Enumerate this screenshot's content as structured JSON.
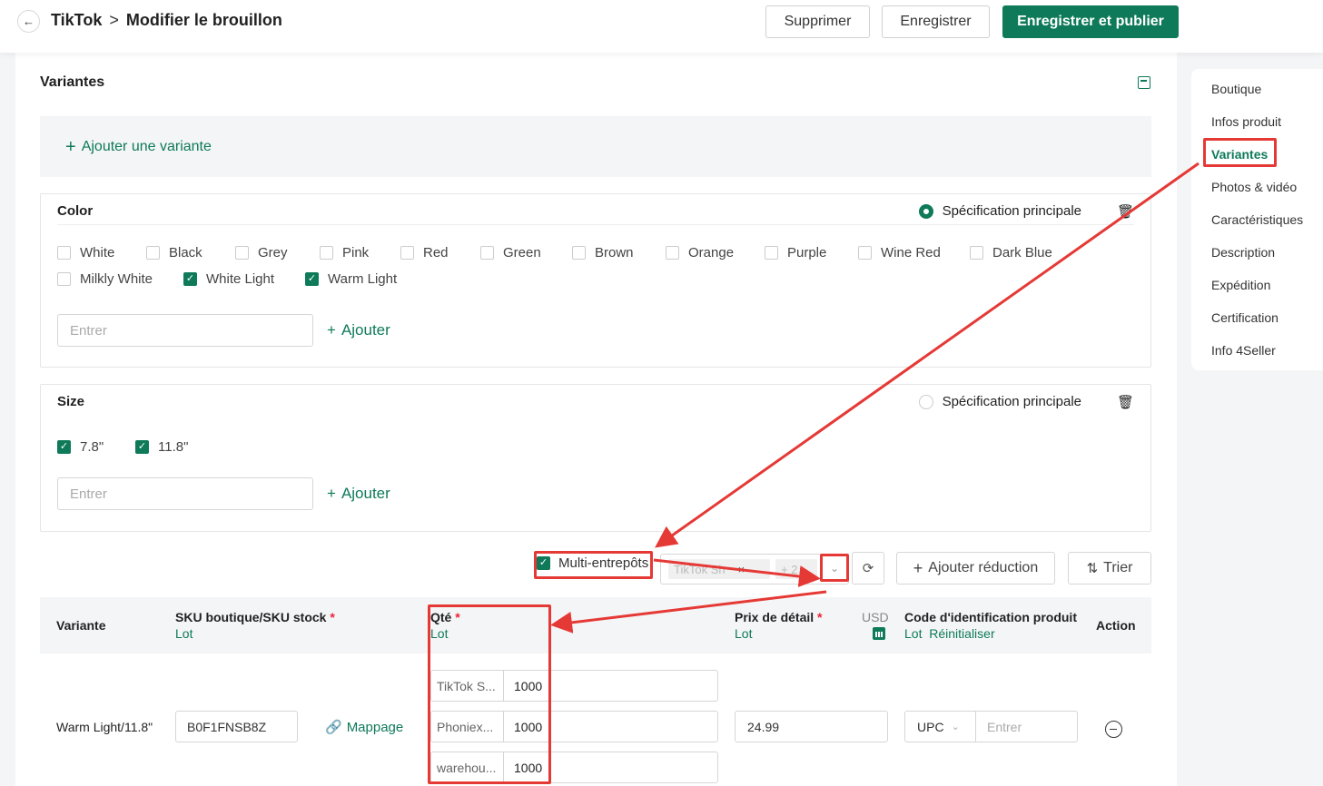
{
  "header": {
    "back_icon": "arrow-left-icon",
    "breadcrumb_root": "TikTok",
    "breadcrumb_sep": ">",
    "breadcrumb_current": "Modifier le brouillon",
    "delete_label": "Supprimer",
    "save_label": "Enregistrer",
    "publish_label": "Enregistrer et publier"
  },
  "section": {
    "title": "Variantes",
    "add_variant_label": "Ajouter une variante"
  },
  "color_spec": {
    "title": "Color",
    "main_spec_label": "Spécification principale",
    "main_spec_selected": true,
    "options": [
      {
        "label": "White",
        "checked": false
      },
      {
        "label": "Black",
        "checked": false
      },
      {
        "label": "Grey",
        "checked": false
      },
      {
        "label": "Pink",
        "checked": false
      },
      {
        "label": "Red",
        "checked": false
      },
      {
        "label": "Green",
        "checked": false
      },
      {
        "label": "Brown",
        "checked": false
      },
      {
        "label": "Orange",
        "checked": false
      },
      {
        "label": "Purple",
        "checked": false
      },
      {
        "label": "Wine Red",
        "checked": false
      },
      {
        "label": "Dark Blue",
        "checked": false
      },
      {
        "label": "Milkly White",
        "checked": false
      },
      {
        "label": "White Light",
        "checked": true
      },
      {
        "label": "Warm Light",
        "checked": true
      }
    ],
    "input_placeholder": "Entrer",
    "add_label": "Ajouter"
  },
  "size_spec": {
    "title": "Size",
    "main_spec_label": "Spécification principale",
    "main_spec_selected": false,
    "options": [
      {
        "label": "7.8\"",
        "checked": true
      },
      {
        "label": "11.8\"",
        "checked": true
      }
    ],
    "input_placeholder": "Entrer",
    "add_label": "Ajouter"
  },
  "toolbar": {
    "multi_warehouse_label": "Multi-entrepôts",
    "multi_warehouse_checked": true,
    "warehouse_tag": "TikTok Sh",
    "warehouse_tag_close": "×",
    "warehouse_more": "+ 2",
    "add_discount_label": "Ajouter réduction",
    "sort_label": "Trier"
  },
  "table": {
    "headers": {
      "variant": "Variante",
      "sku": "SKU boutique/SKU stock",
      "sku_sub": "Lot",
      "qty": "Qté",
      "qty_sub": "Lot",
      "price": "Prix de détail",
      "price_sub": "Lot",
      "currency": "USD",
      "code": "Code d'identification produit",
      "code_sub_1": "Lot",
      "code_sub_2": "Réinitialiser",
      "action": "Action"
    },
    "required_mark": "*",
    "row": {
      "variant": "Warm Light/11.8\"",
      "sku": "B0F1FNSB8Z",
      "mapping_label": "Mappage",
      "quantities": [
        {
          "warehouse": "TikTok S...",
          "qty": "1000"
        },
        {
          "warehouse": "Phoniex...",
          "qty": "1000"
        },
        {
          "warehouse": "warehou...",
          "qty": "1000"
        }
      ],
      "price": "24.99",
      "code_type": "UPC",
      "code_placeholder": "Entrer"
    }
  },
  "rightnav": {
    "items": [
      {
        "label": "Boutique",
        "active": false
      },
      {
        "label": "Infos produit",
        "active": false
      },
      {
        "label": "Variantes",
        "active": true
      },
      {
        "label": "Photos & vidéo",
        "active": false
      },
      {
        "label": "Caractéristiques",
        "active": false
      },
      {
        "label": "Description",
        "active": false
      },
      {
        "label": "Expédition",
        "active": false
      },
      {
        "label": "Certification",
        "active": false
      },
      {
        "label": "Info 4Seller",
        "active": false
      }
    ]
  },
  "colors": {
    "brand": "#0e7a59",
    "annotation": "#e53935",
    "required": "#ee2233"
  }
}
